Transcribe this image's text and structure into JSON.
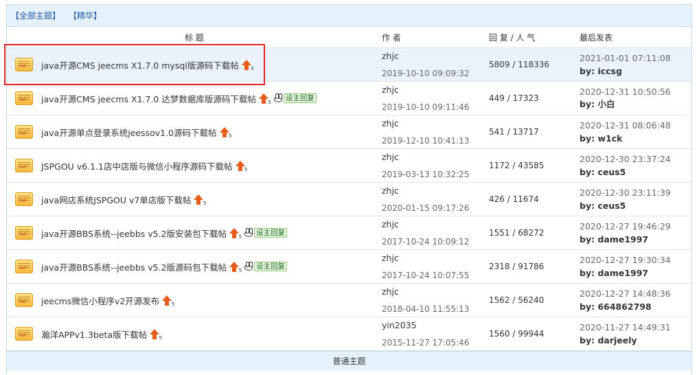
{
  "filters": {
    "all": "【全部主题】",
    "digest": "【精华】"
  },
  "columns": {
    "title": "标 题",
    "author": "作 者",
    "replies": "回 复 / 人 气",
    "last": "最后发表"
  },
  "reply_badge_label": "设主回复",
  "threads": [
    {
      "title": "java开源CMS jeecms X1.7.0 mysql版源码下载帖",
      "author": "zhjc",
      "posted": "2019-10-10 09:09:32",
      "stats": "5809 / 118336",
      "last_time": "2021-01-01 07:11:08",
      "last_by": "by: iccsg",
      "reply_badge": false,
      "badge_num": "5"
    },
    {
      "title": "java开源CMS jeecms X1.7.0 达梦数据库版源码下载帖",
      "author": "zhjc",
      "posted": "2019-10-10 09:11:46",
      "stats": "449 / 17323",
      "last_time": "2020-12-31 10:50:56",
      "last_by": "by: 小白",
      "reply_badge": true,
      "badge_num": "5"
    },
    {
      "title": "java开源单点登录系统jeessov1.0源码下载帖",
      "author": "zhjc",
      "posted": "2019-12-10 10:41:13",
      "stats": "541 / 13717",
      "last_time": "2020-12-31 08:06:48",
      "last_by": "by: w1ck",
      "reply_badge": false,
      "badge_num": "5"
    },
    {
      "title": "JSPGOU v6.1.1店中店版与微信小程序源码下载帖",
      "author": "zhjc",
      "posted": "2019-03-13 10:32:25",
      "stats": "1172 / 43585",
      "last_time": "2020-12-30 23:37:24",
      "last_by": "by: ceus5",
      "reply_badge": false,
      "badge_num": "5"
    },
    {
      "title": "java网店系统JSPGOU v7单店版下载帖",
      "author": "zhjc",
      "posted": "2020-01-15 09:17:26",
      "stats": "426 / 11674",
      "last_time": "2020-12-30 23:11:39",
      "last_by": "by: ceus5",
      "reply_badge": false,
      "badge_num": "5"
    },
    {
      "title": "java开源BBS系统--jeebbs v5.2版安装包下载帖",
      "author": "zhjc",
      "posted": "2017-10-24 10:09:12",
      "stats": "1551 / 68272",
      "last_time": "2020-12-27 19:46:29",
      "last_by": "by: dame1997",
      "reply_badge": true,
      "badge_num": "5"
    },
    {
      "title": "java开源BBS系统--jeebbs v5.2版源码包下载帖",
      "author": "zhjc",
      "posted": "2017-10-24 10:07:55",
      "stats": "2318 / 91786",
      "last_time": "2020-12-27 19:30:34",
      "last_by": "by: dame1997",
      "reply_badge": true,
      "badge_num": "5"
    },
    {
      "title": "jeecms微信小程序v2开源发布",
      "author": "zhjc",
      "posted": "2018-04-10 11:55:13",
      "stats": "1562 / 56240",
      "last_time": "2020-12-27 14:48:36",
      "last_by": "by: 664862798",
      "reply_badge": false,
      "badge_num": "5"
    },
    {
      "title": "瀚洋APPv1.3beta版下载帖",
      "author": "yin2035",
      "posted": "2015-11-27 17:05:46",
      "stats": "1560 / 99944",
      "last_time": "2020-11-27 14:49:31",
      "last_by": "by: darjeely",
      "reply_badge": false,
      "badge_num": "5"
    }
  ],
  "section_label": "普通主题",
  "hot_icon_text": "hot"
}
